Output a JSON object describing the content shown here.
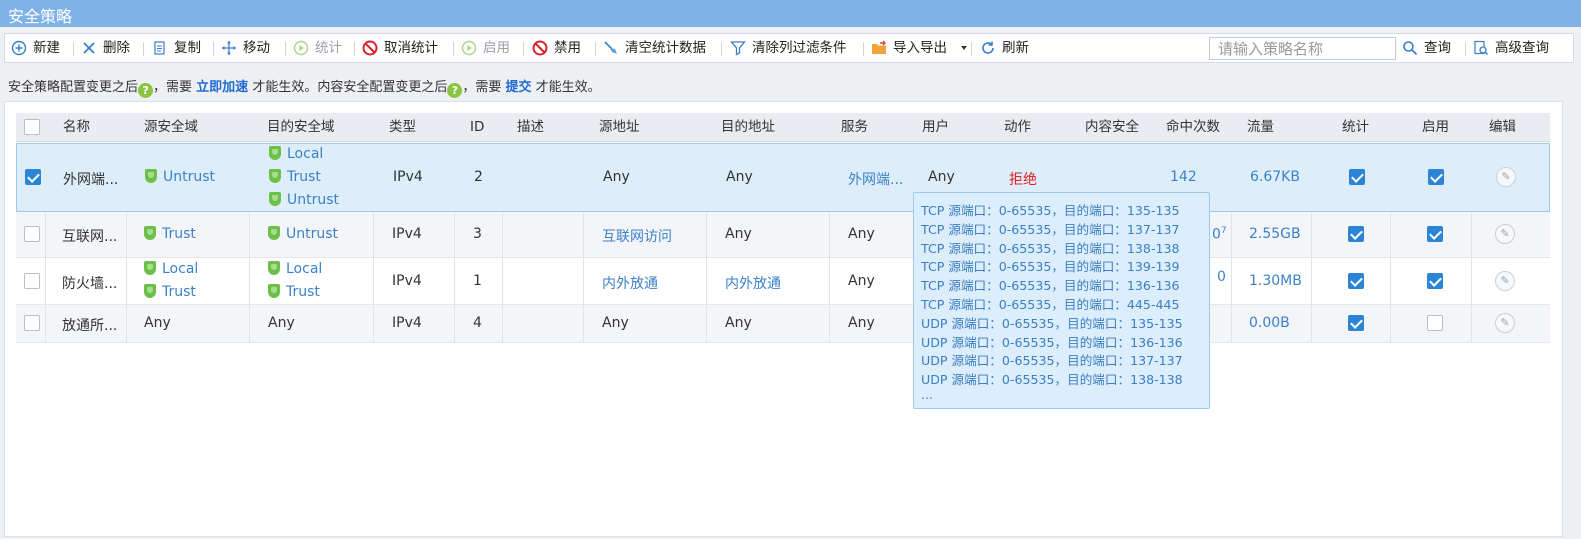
{
  "window": {
    "title": "安全策略"
  },
  "toolbar": {
    "new": "新建",
    "delete": "删除",
    "copy": "复制",
    "move": "移动",
    "stats": "统计",
    "cancel_stats": "取消统计",
    "enable": "启用",
    "disable": "禁用",
    "clear_stats": "清空统计数据",
    "clear_filter": "清除列过滤条件",
    "import_export": "导入导出",
    "refresh": "刷新",
    "search_placeholder": "请输入策略名称",
    "query": "查询",
    "advanced_query": "高级查询"
  },
  "notice": {
    "part1": "安全策略配置变更之后",
    "part2": "，需要",
    "link1": "立即加速",
    "part3": "才能生效。内容安全配置变更之后",
    "part4": "，需要",
    "link2": "提交",
    "part5": "才能生效。",
    "qmark": "?"
  },
  "columns": {
    "name": "名称",
    "src_zone": "源安全域",
    "dst_zone": "目的安全域",
    "type": "类型",
    "id": "ID",
    "desc": "描述",
    "src_addr": "源地址",
    "dst_addr": "目的地址",
    "service": "服务",
    "user": "用户",
    "action": "动作",
    "content_security": "内容安全",
    "hits": "命中次数",
    "traffic": "流量",
    "stats": "统计",
    "enable": "启用",
    "edit": "编辑"
  },
  "rows": [
    {
      "checked": true,
      "name": "外网端...",
      "src_zones": [
        "Untrust"
      ],
      "dst_zones": [
        "Local",
        "Trust",
        "Untrust"
      ],
      "type": "IPv4",
      "id": "2",
      "desc": "",
      "src_addr": "Any",
      "dst_addr": "Any",
      "service": "外网端...",
      "user": "Any",
      "action": "拒绝",
      "hits": "142",
      "traffic": "6.67KB",
      "stats_on": true,
      "enable_on": true
    },
    {
      "checked": false,
      "name": "互联网...",
      "src_zones": [
        "Trust"
      ],
      "dst_zones": [
        "Untrust"
      ],
      "type": "IPv4",
      "id": "3",
      "desc": "",
      "src_addr": "互联网访问",
      "dst_addr": "Any",
      "service": "Any",
      "hits_partial": "0",
      "hits_sup": "7",
      "traffic": "2.55GB",
      "stats_on": true,
      "enable_on": true
    },
    {
      "checked": false,
      "name": "防火墙...",
      "src_zones": [
        "Local",
        "Trust"
      ],
      "dst_zones": [
        "Local",
        "Trust"
      ],
      "type": "IPv4",
      "id": "1",
      "desc": "",
      "src_addr": "内外放通",
      "dst_addr": "内外放通",
      "service": "Any",
      "hits_partial": "0",
      "traffic": "1.30MB",
      "stats_on": true,
      "enable_on": true
    },
    {
      "checked": false,
      "name": "放通所...",
      "src_zones_text": "Any",
      "dst_zones_text": "Any",
      "type": "IPv4",
      "id": "4",
      "desc": "",
      "src_addr": "Any",
      "dst_addr": "Any",
      "service": "Any",
      "traffic": "0.00B",
      "stats_on": true,
      "enable_on": false
    }
  ],
  "tooltip": {
    "lines": [
      "TCP 源端口：0-65535，目的端口：135-135",
      "TCP 源端口：0-65535，目的端口：137-137",
      "TCP 源端口：0-65535，目的端口：138-138",
      "TCP 源端口：0-65535，目的端口：139-139",
      "TCP 源端口：0-65535，目的端口：136-136",
      "TCP 源端口：0-65535，目的端口：445-445",
      "UDP 源端口：0-65535，目的端口：135-135",
      "UDP 源端口：0-65535，目的端口：136-136",
      "UDP 源端口：0-65535，目的端口：137-137",
      "UDP 源端口：0-65535，目的端口：138-138",
      "..."
    ]
  },
  "colors": {
    "titlebar": "#7fb3e8",
    "link": "#3c82c8",
    "deny": "#e02020",
    "check": "#2b84d6",
    "shield": "#6cc04a"
  },
  "icons": {
    "new": "plus-circle-icon",
    "delete": "x-icon",
    "copy": "copy-icon",
    "move": "move-arrows-icon",
    "stats": "play-circle-icon",
    "cancel_stats": "ban-icon",
    "enable": "play-circle-icon",
    "disable": "ban-icon",
    "clear_stats": "broom-icon",
    "clear_filter": "filter-icon",
    "import_export": "folder-arrow-icon",
    "refresh": "refresh-icon",
    "query": "search-icon",
    "advanced_query": "advanced-search-icon",
    "zone": "shield-icon",
    "edit": "pencil-icon"
  }
}
